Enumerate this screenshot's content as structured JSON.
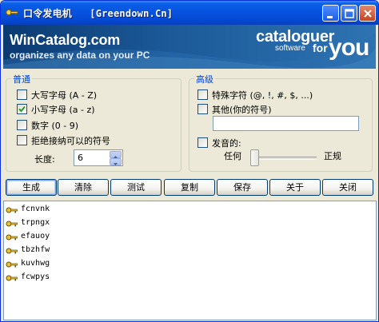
{
  "window": {
    "title": "口令发电机   [Greendown.Cn]"
  },
  "banner": {
    "brand": "WinCatalog.com",
    "tagline": "organizes any data on your PC",
    "right_word": "cataloguer",
    "right_software": "software",
    "right_for": "for",
    "right_you": "you"
  },
  "general": {
    "legend": "普通",
    "options": [
      {
        "label": "大写字母 (A - Z)",
        "checked": false
      },
      {
        "label": "小写字母 (a - z)",
        "checked": true
      },
      {
        "label": "数字 (0 - 9)",
        "checked": false
      },
      {
        "label": "拒绝接纳可以的符号",
        "checked": false
      }
    ],
    "length_label": "长度:",
    "length_value": "6"
  },
  "advanced": {
    "legend": "高级",
    "special_label": "特殊字符 (@, !, #, $, ...)",
    "special_checked": false,
    "other_label": "其他(你的符号)",
    "other_checked": false,
    "other_value": "",
    "pronounce_label": "发音的:",
    "pronounce_checked": false,
    "slider_min_label": "任何",
    "slider_max_label": "正规",
    "slider_level": 0
  },
  "buttons": {
    "generate": "生成",
    "clear": "清除",
    "test": "测试",
    "copy": "复制",
    "save": "保存",
    "about": "关于",
    "close": "关闭"
  },
  "results": [
    "fcnvnk",
    "trpngx",
    "efauoy",
    "tbzhfw",
    "kuvhwg",
    "fcwpys"
  ]
}
